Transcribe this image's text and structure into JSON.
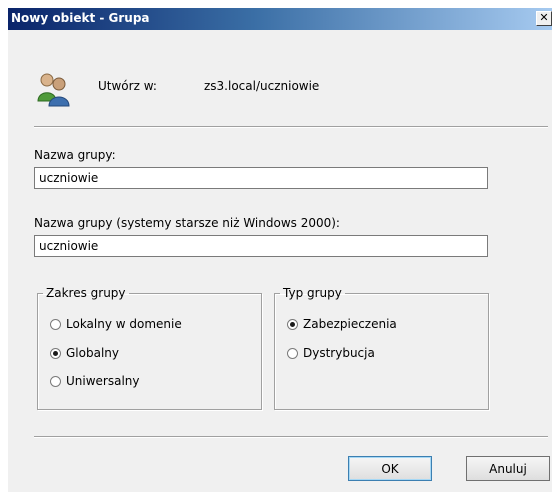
{
  "window": {
    "title": "Nowy obiekt - Grupa",
    "close_glyph": "✕"
  },
  "header": {
    "icon": "group-users-icon",
    "create_label": "Utwórz w:",
    "create_path": "zs3.local/uczniowie"
  },
  "form": {
    "group_name_label": "Nazwa grupy:",
    "group_name_value": "uczniowie",
    "legacy_name_label": "Nazwa grupy (systemy starsze niż Windows 2000):",
    "legacy_name_value": "uczniowie"
  },
  "scope": {
    "legend": "Zakres grupy",
    "options": [
      {
        "label": "Lokalny w domenie",
        "selected": false
      },
      {
        "label": "Globalny",
        "selected": true
      },
      {
        "label": "Uniwersalny",
        "selected": false
      }
    ]
  },
  "type": {
    "legend": "Typ grupy",
    "options": [
      {
        "label": "Zabezpieczenia",
        "selected": true
      },
      {
        "label": "Dystrybucja",
        "selected": false
      }
    ]
  },
  "buttons": {
    "ok_label": "OK",
    "cancel_label": "Anuluj"
  }
}
